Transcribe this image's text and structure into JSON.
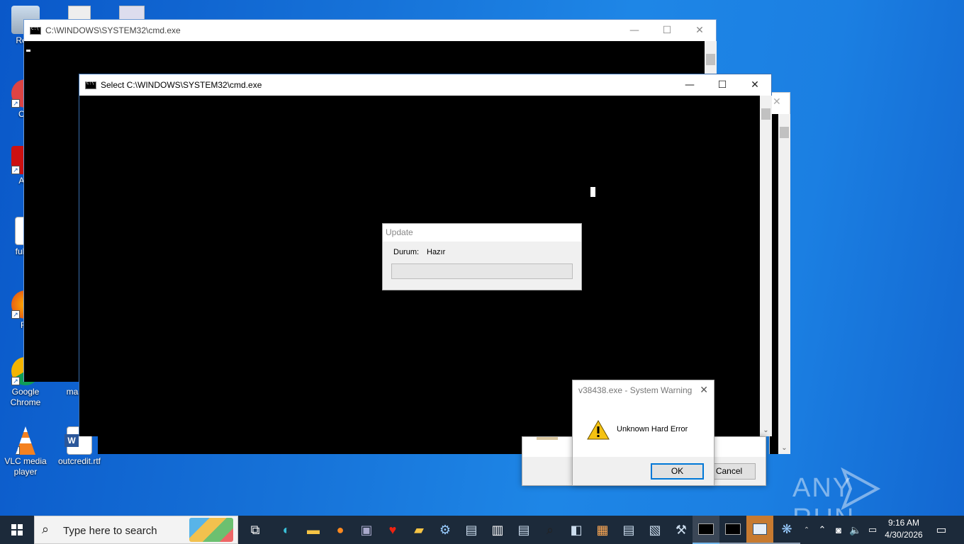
{
  "desktop": {
    "icons": [
      {
        "label": "Recy"
      },
      {
        "label": "CCl"
      },
      {
        "label": "Ad Acr"
      },
      {
        "label": "fullpri"
      },
      {
        "label": "Fir"
      },
      {
        "label": "Google Chrome"
      },
      {
        "label": "maste"
      },
      {
        "label": "VLC media player"
      },
      {
        "label": "outcredit.rtf"
      }
    ]
  },
  "back_cmd": {
    "title": "C:\\WINDOWS\\SYSTEM32\\cmd.exe",
    "minimize": "—",
    "maximize": "☐",
    "close": "✕"
  },
  "front_cmd": {
    "title": "Select C:\\WINDOWS\\SYSTEM32\\cmd.exe",
    "minimize": "—",
    "maximize": "☐",
    "close": "✕"
  },
  "update_dialog": {
    "title": "Update",
    "status_label": "Durum:",
    "status_value": "Hazır",
    "progress": 0
  },
  "warning_dialog": {
    "title": "v38438.exe - System Warning",
    "close": "✕",
    "message": "Unknown Hard Error",
    "ok_label": "OK",
    "icon": "warning-icon"
  },
  "background_dialog": {
    "cancel_label": "Cancel"
  },
  "taskbar": {
    "search_placeholder": "Type here to search",
    "time": "9:16 AM",
    "date": "4/30/2026"
  },
  "watermark": "ANY RUN"
}
